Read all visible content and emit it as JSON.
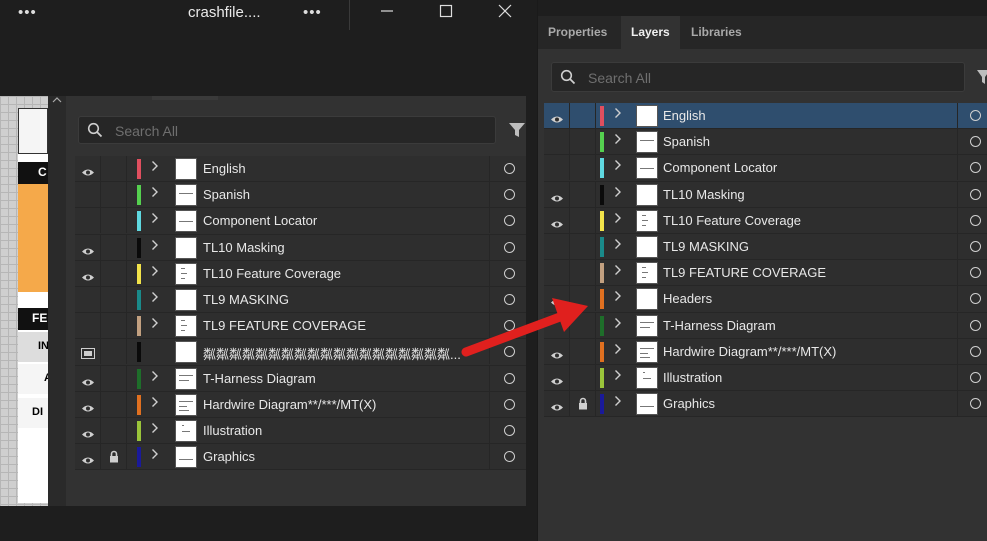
{
  "left_window": {
    "title": "crashfile....",
    "menu_dots_left": "•••",
    "menu_dots_right": "•••",
    "search_placeholder": "Search All",
    "layers": [
      {
        "name": "English",
        "color": "#e04f5f",
        "visible": true,
        "locked": false,
        "expander": true
      },
      {
        "name": "Spanish",
        "color": "#55d04f",
        "visible": false,
        "locked": false,
        "expander": true
      },
      {
        "name": "Component Locator",
        "color": "#5fd8e0",
        "visible": false,
        "locked": false,
        "expander": true
      },
      {
        "name": "TL10 Masking",
        "color": "#0a0a0a",
        "visible": true,
        "locked": false,
        "expander": true
      },
      {
        "name": "TL10 Feature Coverage",
        "color": "#f2e34a",
        "visible": true,
        "locked": false,
        "expander": true
      },
      {
        "name": "TL9 MASKING",
        "color": "#1a8a8a",
        "visible": false,
        "locked": false,
        "expander": true
      },
      {
        "name": "TL9 FEATURE COVERAGE",
        "color": "#c2a080",
        "visible": false,
        "locked": false,
        "expander": true
      },
      {
        "name": "粼粼粼粼粼粼粼粼粼粼粼粼粼粼粼粼粼粼粼...",
        "color": "#0a0a0a",
        "visible": false,
        "locked": false,
        "expander": false,
        "template": true
      },
      {
        "name": "T-Harness Diagram",
        "color": "#1e6e2a",
        "visible": true,
        "locked": false,
        "expander": true
      },
      {
        "name": "Hardwire Diagram**/***/MT(X)",
        "color": "#e07020",
        "visible": true,
        "locked": false,
        "expander": true
      },
      {
        "name": "Illustration",
        "color": "#9ac43a",
        "visible": true,
        "locked": false,
        "expander": true
      },
      {
        "name": "Graphics",
        "color": "#1a1a9a",
        "visible": true,
        "locked": true,
        "expander": true
      }
    ]
  },
  "right_panel": {
    "tabs": [
      {
        "label": "Properties",
        "active": false
      },
      {
        "label": "Layers",
        "active": true
      },
      {
        "label": "Libraries",
        "active": false
      }
    ],
    "search_placeholder": "Search All",
    "layers": [
      {
        "name": "English",
        "color": "#e04f5f",
        "visible": true,
        "locked": false,
        "selected": true
      },
      {
        "name": "Spanish",
        "color": "#55d04f",
        "visible": false,
        "locked": false,
        "selected": false
      },
      {
        "name": "Component Locator",
        "color": "#5fd8e0",
        "visible": false,
        "locked": false,
        "selected": false
      },
      {
        "name": "TL10 Masking",
        "color": "#0a0a0a",
        "visible": true,
        "locked": false,
        "selected": false
      },
      {
        "name": "TL10 Feature Coverage",
        "color": "#f2e34a",
        "visible": true,
        "locked": false,
        "selected": false
      },
      {
        "name": "TL9 MASKING",
        "color": "#1a8a8a",
        "visible": false,
        "locked": false,
        "selected": false
      },
      {
        "name": "TL9 FEATURE COVERAGE",
        "color": "#c2a080",
        "visible": false,
        "locked": false,
        "selected": false
      },
      {
        "name": "Headers",
        "color": "#e07020",
        "visible": true,
        "locked": false,
        "selected": false
      },
      {
        "name": "T-Harness Diagram",
        "color": "#1e6e2a",
        "visible": false,
        "locked": false,
        "selected": false
      },
      {
        "name": "Hardwire Diagram**/***/MT(X)",
        "color": "#e07020",
        "visible": true,
        "locked": false,
        "selected": false
      },
      {
        "name": "Illustration",
        "color": "#9ac43a",
        "visible": true,
        "locked": false,
        "selected": false
      },
      {
        "name": "Graphics",
        "color": "#1a1a9a",
        "visible": true,
        "locked": true,
        "selected": false
      }
    ]
  },
  "artboard_labels": [
    "C",
    "FE",
    "IN",
    "A",
    "DI"
  ],
  "colors": {
    "arrow": "#e0201e",
    "selection": "#2f4e6e",
    "panel_bg": "#323232"
  }
}
